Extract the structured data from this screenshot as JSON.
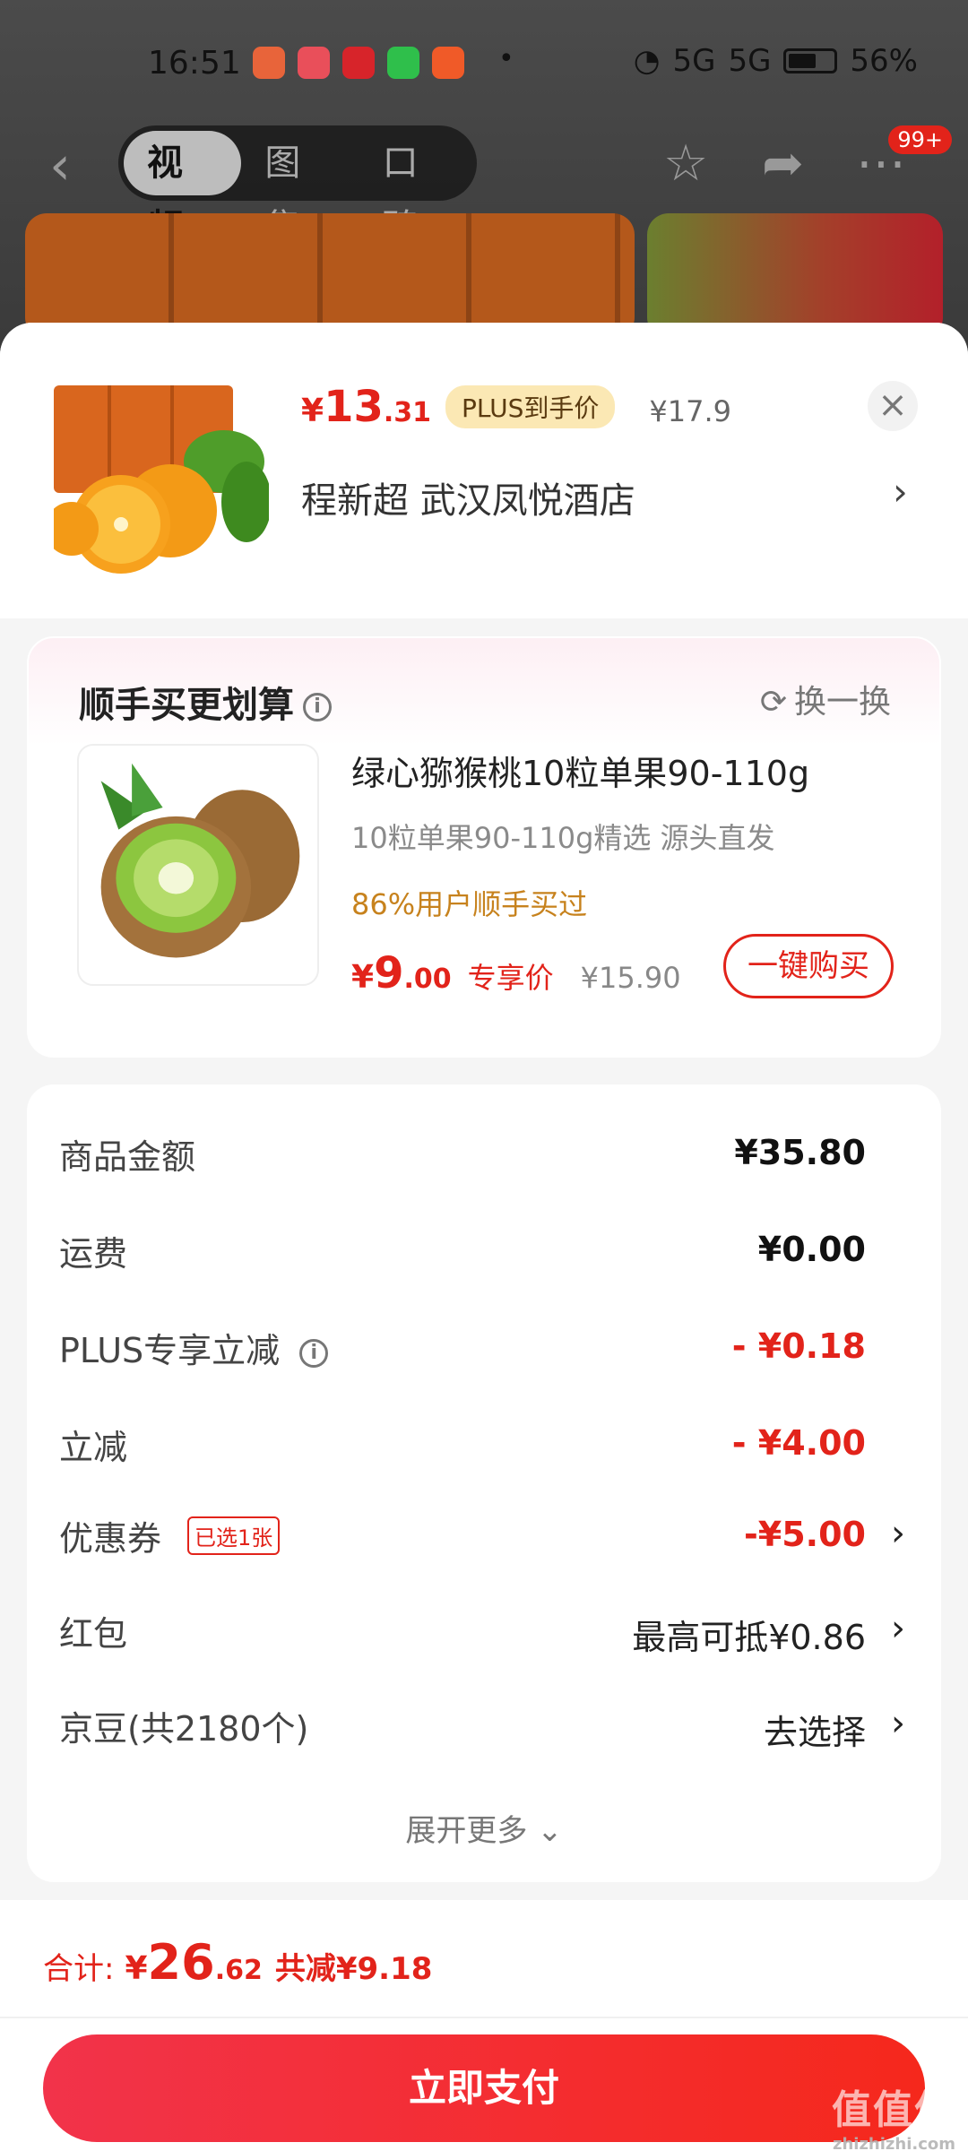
{
  "status": {
    "time": "16:51",
    "network": "5G",
    "battery": "56%"
  },
  "nav": {
    "tabs": [
      "视频",
      "图集",
      "口碑"
    ],
    "active_tab": "视频",
    "badge": "99+"
  },
  "product": {
    "price_currency": "¥",
    "price_int": "13",
    "price_dec": ".31",
    "plus_tag": "PLUS到手价",
    "orig_price": "¥17.9",
    "address": "程新超  武汉凤悦酒店"
  },
  "recommend": {
    "title": "顺手买更划算",
    "swap": "换一换",
    "name": "绿心猕猴桃10粒单果90-110g",
    "desc": "10粒单果90-110g精选   源头直发",
    "bought": "86%用户顺手买过",
    "price_currency": "¥",
    "price_int": "9",
    "price_dec": ".00",
    "price_note": "专享价",
    "orig_price": "¥15.90",
    "buy_button": "一键购买"
  },
  "details": {
    "rows": [
      {
        "label": "商品金额",
        "value": "¥35.80"
      },
      {
        "label": "运费",
        "value": "¥0.00"
      },
      {
        "label": "PLUS专享立减",
        "value": "- ¥0.18"
      },
      {
        "label": "立减",
        "value": "- ¥4.00"
      },
      {
        "label": "优惠券",
        "tag": "已选1张",
        "value": "-¥5.00"
      },
      {
        "label": "红包",
        "value": "最高可抵¥0.86"
      },
      {
        "label": "京豆(共2180个)",
        "value": "去选择"
      }
    ],
    "expand": "展开更多"
  },
  "summary": {
    "label": "合计:",
    "currency": "¥",
    "int": "26",
    "dec": ".62",
    "saved": "共减¥9.18",
    "pay_button": "立即支付"
  },
  "watermark": {
    "main": "值值值",
    "sub": "zhizhizhi.com"
  },
  "colors": {
    "accent": "#e2231a",
    "plus_tag_bg": "#fbe8b4",
    "bought": "#c7821d"
  },
  "icons": [
    "back-arrow-icon",
    "star-icon",
    "share-icon",
    "more-icon",
    "close-icon",
    "chevron-right-icon",
    "info-icon",
    "refresh-icon",
    "chevron-down-icon"
  ]
}
